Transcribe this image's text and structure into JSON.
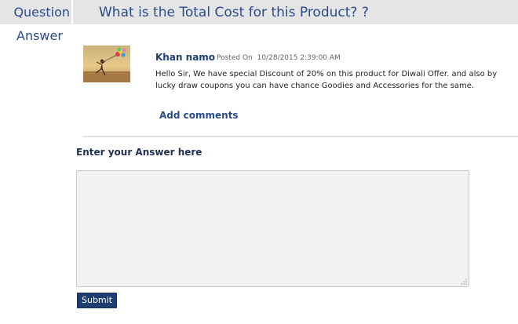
{
  "question": {
    "label": "Question",
    "text": "What is the Total Cost for this Product? ?"
  },
  "answer_section": {
    "label": "Answer",
    "answers": [
      {
        "author": "Khan namo",
        "posted_label": "Posted On",
        "posted_date": "10/28/2015 2:39:00 AM",
        "body": "Hello Sir, We have special Discount of 20% on this product for Diwali Offer. and also by lucky draw coupons you can have chance Goodies and Accessories for the same.",
        "add_comments_label": "Add comments"
      }
    ]
  },
  "form": {
    "prompt": "Enter your Answer here",
    "answer_value": "",
    "submit_label": "Submit"
  },
  "colors": {
    "accent": "#2a4a8a",
    "button": "#1f3d6e",
    "header_bar": "#e5e5e5"
  }
}
